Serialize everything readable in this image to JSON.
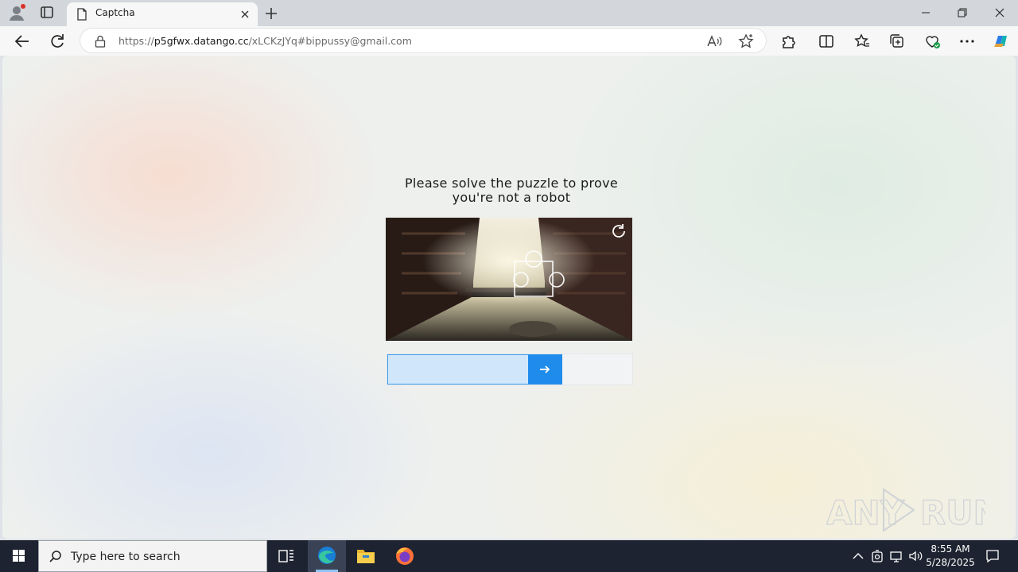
{
  "browser": {
    "tab_title": "Captcha",
    "url_prefix": "https://",
    "url_domain": "p5gfwx.datango.cc",
    "url_rest": "/xLCKzJYq#bippussy@gmail.com"
  },
  "page": {
    "prompt_line1": "Please solve the puzzle to prove",
    "prompt_line2": "you're not a robot"
  },
  "watermark": {
    "text_left": "ANY",
    "text_right": "RUN"
  },
  "taskbar": {
    "search_placeholder": "Type here to search",
    "time": "8:55 AM",
    "date": "5/28/2025"
  },
  "colors": {
    "slider_accent": "#1f8ceb",
    "slider_fill": "#d0e7fb",
    "taskbar_bg": "#1d2330"
  }
}
